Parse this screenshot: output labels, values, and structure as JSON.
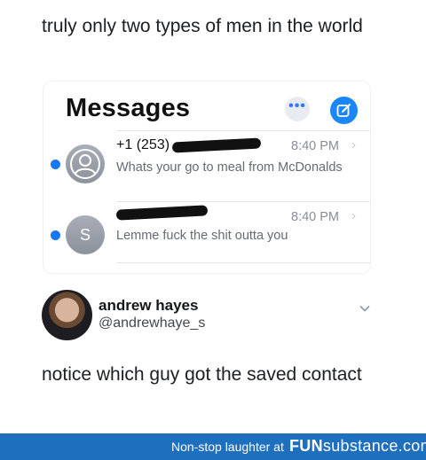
{
  "post": {
    "caption": "truly only two types of men in the world"
  },
  "messages": {
    "title": "Messages",
    "more_icon": "ellipsis-icon",
    "compose_icon": "compose-icon",
    "accent": "#1877f2",
    "conversations": [
      {
        "sender": "+1 (253)",
        "time": "8:40 PM",
        "preview": "Whats your go to meal from McDonalds",
        "avatar_icon": "person-silhouette-icon",
        "unread": true
      },
      {
        "sender": "S",
        "time": "8:40 PM",
        "preview": "Lemme fuck the shit outta you",
        "avatar_letter": "S",
        "unread": true
      }
    ]
  },
  "tweet": {
    "author_name": "andrew hayes",
    "author_handle": "@andrewhaye_s",
    "text": "notice which guy got the saved contact"
  },
  "footer": {
    "tagline": "Non-stop laughter at",
    "logo_bold": "FUN",
    "logo_rest": "substance.com",
    "background": "#1f6fbf"
  }
}
